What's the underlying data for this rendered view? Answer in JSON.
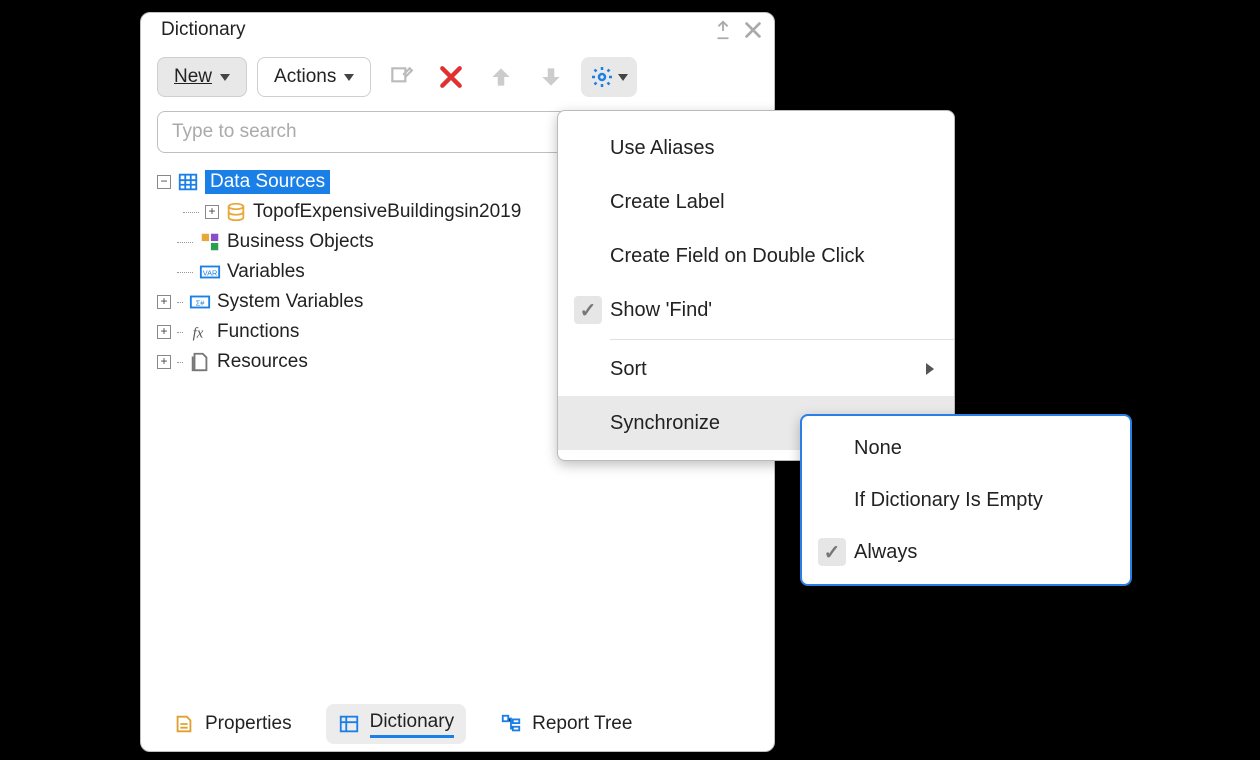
{
  "panel": {
    "title": "Dictionary"
  },
  "toolbar": {
    "new_label": "New",
    "actions_label": "Actions"
  },
  "search": {
    "placeholder": "Type to search"
  },
  "tree": {
    "data_sources": "Data Sources",
    "table1": "TopofExpensiveBuildingsin2019",
    "business_objects": "Business Objects",
    "variables": "Variables",
    "system_variables": "System Variables",
    "functions": "Functions",
    "resources": "Resources"
  },
  "tabs": {
    "properties": "Properties",
    "dictionary": "Dictionary",
    "report_tree": "Report Tree"
  },
  "settings_menu": {
    "use_aliases": "Use Aliases",
    "create_label": "Create Label",
    "create_field": "Create Field on Double Click",
    "show_find": "Show 'Find'",
    "sort": "Sort",
    "synchronize": "Synchronize"
  },
  "sync_menu": {
    "none": "None",
    "if_empty": "If Dictionary Is Empty",
    "always": "Always"
  }
}
